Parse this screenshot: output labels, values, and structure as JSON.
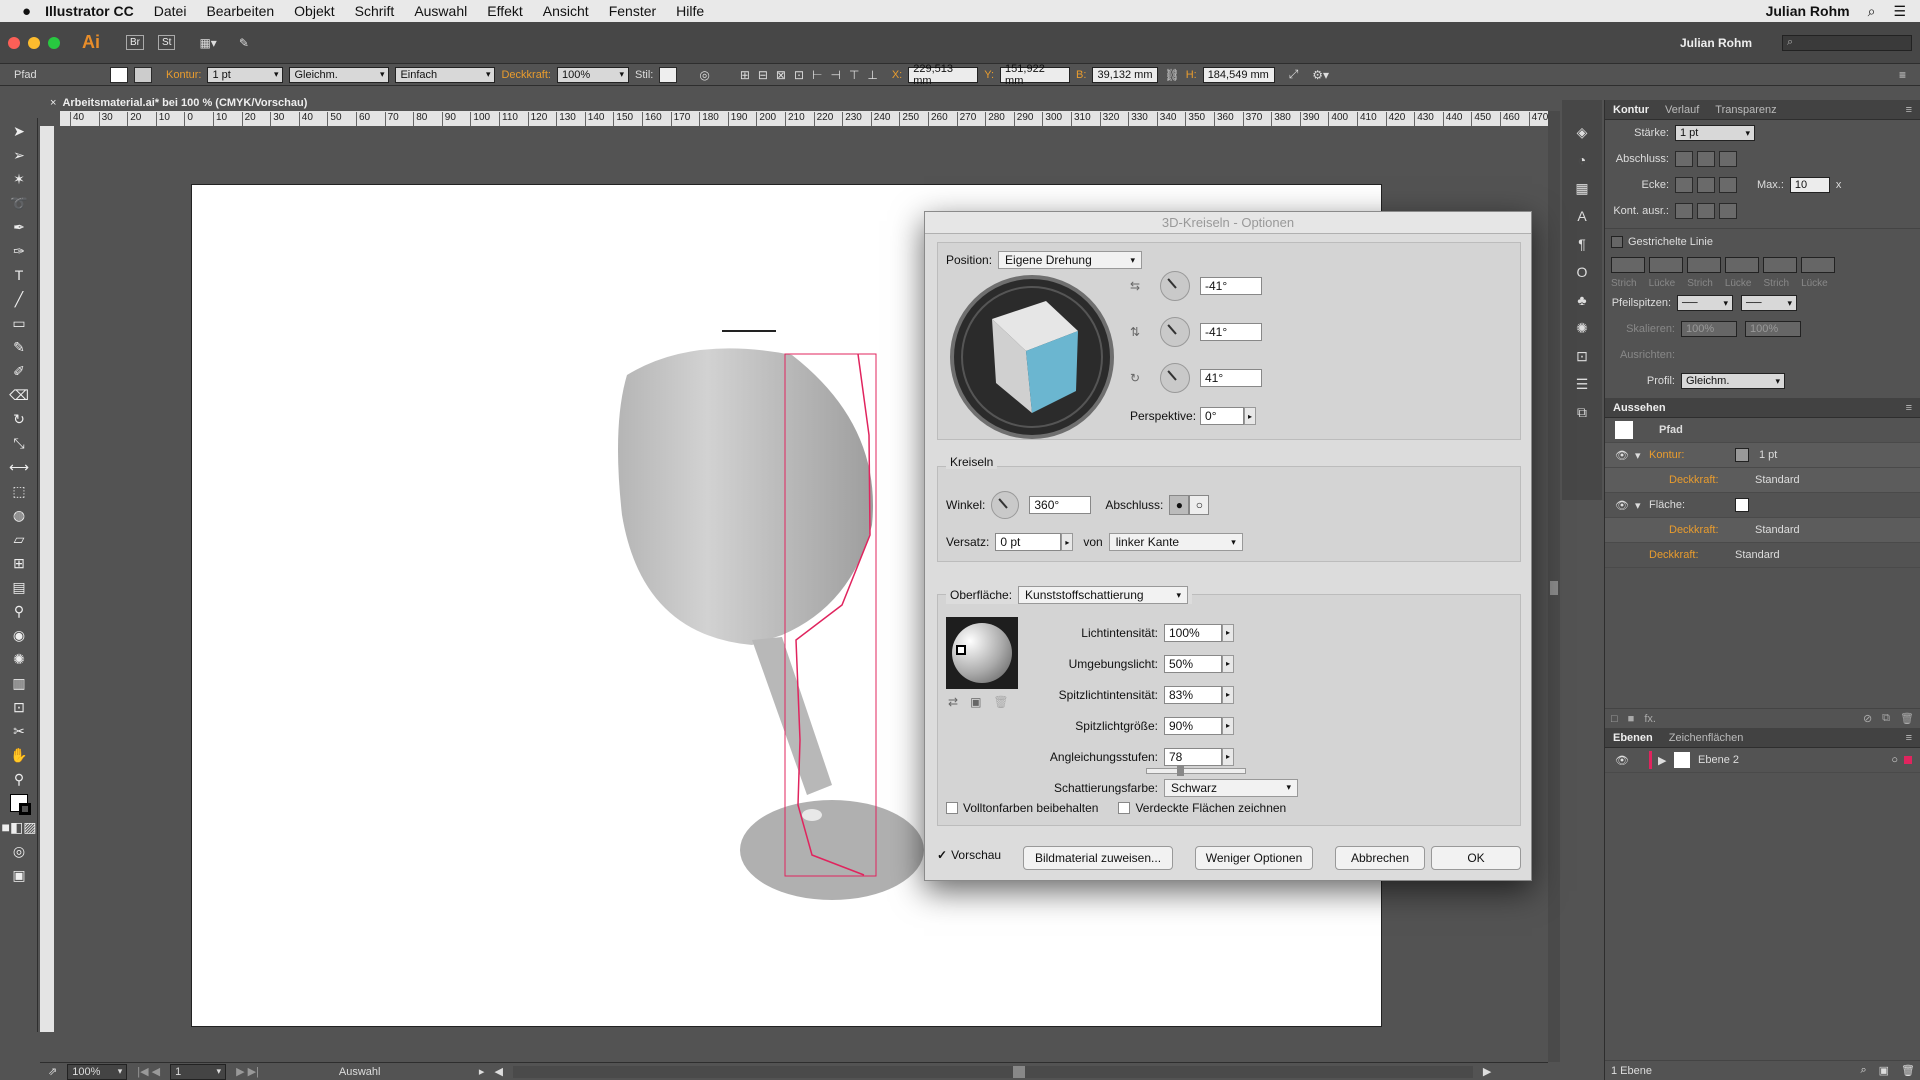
{
  "menubar": {
    "app": "Illustrator CC",
    "items": [
      "Datei",
      "Bearbeiten",
      "Objekt",
      "Schrift",
      "Auswahl",
      "Effekt",
      "Ansicht",
      "Fenster",
      "Hilfe"
    ],
    "user": "Julian Rohm"
  },
  "control": {
    "ai_label": "Ai",
    "br": "Br",
    "st": "St",
    "user": "Julian Rohm"
  },
  "options": {
    "object_type": "Pfad",
    "kontur_label": "Kontur:",
    "kontur_value": "1 pt",
    "stroke_profile": "Gleichm.",
    "brush": "Einfach",
    "deckkraft_label": "Deckkraft:",
    "deckkraft_value": "100%",
    "stil_label": "Stil:",
    "x_label": "X:",
    "x_value": "229,513 mm",
    "y_label": "Y:",
    "y_value": "151,922 mm",
    "b_label": "B:",
    "b_value": "39,132 mm",
    "h_label": "H:",
    "h_value": "184,549 mm"
  },
  "doctab": {
    "title": "Arbeitsmaterial.ai* bei 100 % (CMYK/Vorschau)"
  },
  "ruler": {
    "labels": [
      "40",
      "30",
      "20",
      "10",
      "0",
      "10",
      "20",
      "30",
      "40",
      "50",
      "60",
      "70",
      "80",
      "90",
      "100",
      "110",
      "120",
      "130",
      "140",
      "150",
      "160",
      "170",
      "180",
      "190",
      "200",
      "210",
      "220",
      "230",
      "240",
      "250",
      "260",
      "270",
      "280",
      "290",
      "300",
      "310",
      "320",
      "330",
      "340",
      "350",
      "360",
      "370",
      "380",
      "390",
      "400",
      "410",
      "420",
      "430",
      "440",
      "450",
      "460",
      "470"
    ]
  },
  "dialog": {
    "title": "3D-Kreiseln - Optionen",
    "position_label": "Position:",
    "position_value": "Eigene Drehung",
    "rot_x": "-41°",
    "rot_y": "-41°",
    "rot_z": "41°",
    "perspektive_label": "Perspektive:",
    "perspektive_value": "0°",
    "kreiseln_title": "Kreiseln",
    "winkel_label": "Winkel:",
    "winkel_value": "360°",
    "abschluss_label": "Abschluss:",
    "versatz_label": "Versatz:",
    "versatz_value": "0 pt",
    "von_label": "von",
    "von_value": "linker Kante",
    "oberflaeche_label": "Oberfläche:",
    "oberflaeche_value": "Kunststoffschattierung",
    "licht_label": "Lichtintensität:",
    "licht_value": "100%",
    "umgebung_label": "Umgebungslicht:",
    "umgebung_value": "50%",
    "spitzint_label": "Spitzlichtintensität:",
    "spitzint_value": "83%",
    "spitzgr_label": "Spitzlichtgröße:",
    "spitzgr_value": "90%",
    "angleich_label": "Angleichungsstufen:",
    "angleich_value": "78",
    "schatt_label": "Schattierungsfarbe:",
    "schatt_value": "Schwarz",
    "voll_label": "Volltonfarben beibehalten",
    "verdeckt_label": "Verdeckte Flächen zeichnen",
    "vorschau_label": "Vorschau",
    "btn_bild": "Bildmaterial zuweisen...",
    "btn_weniger": "Weniger Optionen",
    "btn_abbrechen": "Abbrechen",
    "btn_ok": "OK"
  },
  "rpanel": {
    "tabs": [
      "Kontur",
      "Verlauf",
      "Transparenz"
    ],
    "staerke_label": "Stärke:",
    "staerke_value": "1 pt",
    "abschluss_label": "Abschluss:",
    "ecke_label": "Ecke:",
    "max_label": "Max.:",
    "max_value": "10",
    "max_unit": "x",
    "kontausr_label": "Kont. ausr.:",
    "gestrichelt_label": "Gestrichelte Linie",
    "dash_labels": [
      "Strich",
      "Lücke",
      "Strich",
      "Lücke",
      "Strich",
      "Lücke"
    ],
    "pfeil_label": "Pfeilspitzen:",
    "skalieren_label": "Skalieren:",
    "skal1": "100%",
    "skal2": "100%",
    "ausrichten_label": "Ausrichten:",
    "profil_label": "Profil:",
    "profil_value": "Gleichm.",
    "aussehen_title": "Aussehen",
    "app_pfad": "Pfad",
    "app_kontur": "Kontur:",
    "app_kontur_val": "1 pt",
    "app_deck": "Deckkraft:",
    "app_standard": "Standard",
    "app_flaeche": "Fläche:",
    "ebenen_tabs": [
      "Ebenen",
      "Zeichenflächen"
    ],
    "layer_name": "Ebene 2",
    "layer_count": "1 Ebene"
  },
  "status": {
    "zoom": "100%",
    "page": "1",
    "mode": "Auswahl"
  },
  "colors": {
    "accent_pink": "#e0245e",
    "cube_blue": "#6bb6d0",
    "orange_label": "#e99c2e"
  }
}
